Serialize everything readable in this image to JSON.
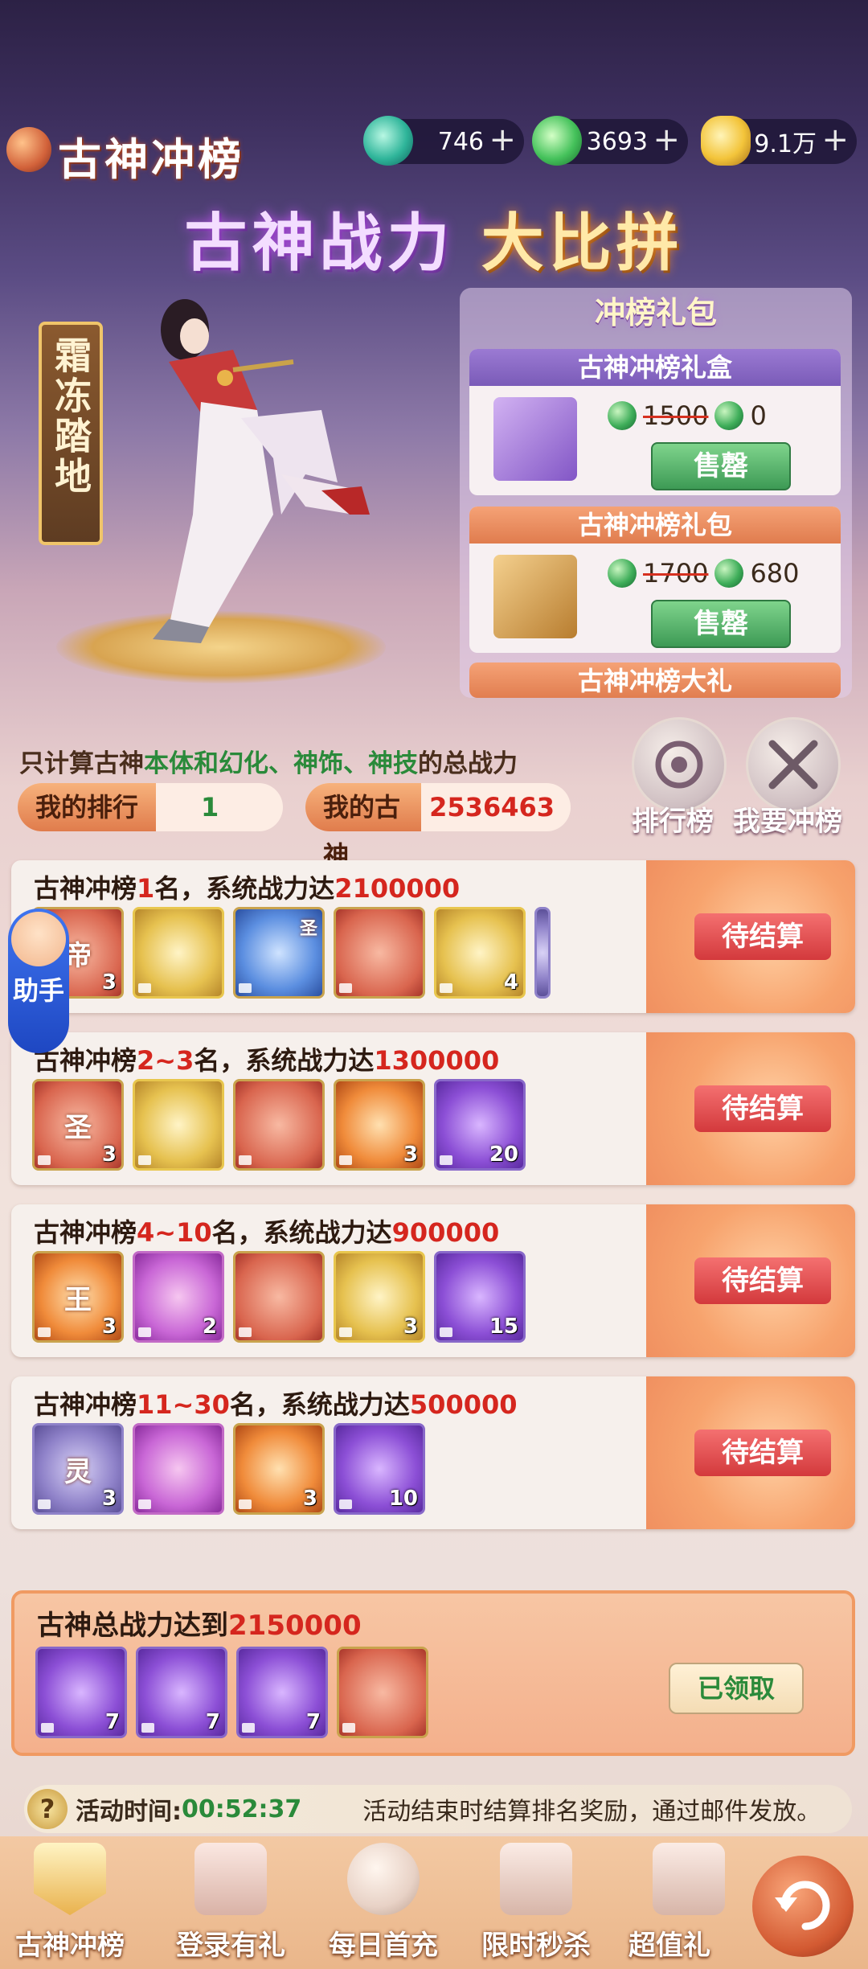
{
  "header": {
    "title": "古神冲榜",
    "currencies": [
      {
        "name": "jade-currency",
        "value": "746"
      },
      {
        "name": "green-jade-currency",
        "value": "3693"
      },
      {
        "name": "gold-ingot-currency",
        "value": "9.1万"
      }
    ]
  },
  "headline": {
    "part1": "古神战力",
    "part2": "大比拼"
  },
  "character": {
    "banner": "霜冻踏地"
  },
  "gift_panel": {
    "title": "冲榜礼包",
    "gifts": [
      {
        "name": "古神冲榜礼盒",
        "old_price": "1500",
        "price": "0",
        "button": "售罄"
      },
      {
        "name": "古神冲榜礼包",
        "old_price": "1700",
        "price": "680",
        "button": "售罄"
      },
      {
        "name": "古神冲榜大礼"
      }
    ]
  },
  "info": {
    "note_prefix": "只计算古神",
    "note_highlight": "本体和幻化、神饰、神技",
    "note_suffix": "的总战力",
    "my_rank_label": "我的排行",
    "my_rank_value": "1",
    "my_god_label": "我的古神",
    "my_god_value": "2536463",
    "rank_board_label": "排行榜",
    "go_rank_label": "我要冲榜"
  },
  "rank_cards": [
    {
      "prefix": "古神冲榜",
      "rank": "1",
      "middle": "名，系统战力达",
      "power": "2100000",
      "button": "待结算",
      "items": [
        {
          "glyph": "帝",
          "count": "3"
        },
        {
          "glyph": "",
          "count": ""
        },
        {
          "glyph": "圣",
          "count": ""
        },
        {
          "glyph": "",
          "count": ""
        },
        {
          "glyph": "",
          "count": "4"
        }
      ]
    },
    {
      "prefix": "古神冲榜",
      "rank": "2~3",
      "middle": "名，系统战力达",
      "power": "1300000",
      "button": "待结算",
      "items": [
        {
          "glyph": "圣",
          "count": "3"
        },
        {
          "glyph": "",
          "count": ""
        },
        {
          "glyph": "",
          "count": ""
        },
        {
          "glyph": "",
          "count": "3"
        },
        {
          "glyph": "",
          "count": "20"
        }
      ]
    },
    {
      "prefix": "古神冲榜",
      "rank": "4~10",
      "middle": "名，系统战力达",
      "power": "900000",
      "button": "待结算",
      "items": [
        {
          "glyph": "王",
          "count": "3"
        },
        {
          "glyph": "",
          "count": "2"
        },
        {
          "glyph": "",
          "count": ""
        },
        {
          "glyph": "",
          "count": "3"
        },
        {
          "glyph": "",
          "count": "15"
        }
      ]
    },
    {
      "prefix": "古神冲榜",
      "rank": "11~30",
      "middle": "名，系统战力达",
      "power": "500000",
      "button": "待结算",
      "items": [
        {
          "glyph": "灵",
          "count": "3"
        },
        {
          "glyph": "",
          "count": ""
        },
        {
          "glyph": "",
          "count": "3"
        },
        {
          "glyph": "",
          "count": "10"
        }
      ]
    }
  ],
  "total_card": {
    "prefix": "古神总战力达到",
    "power": "2150000",
    "button": "已领取",
    "items": [
      {
        "count": "7"
      },
      {
        "count": "7"
      },
      {
        "count": "7"
      },
      {
        "count": ""
      }
    ]
  },
  "helper": {
    "label": "助手"
  },
  "time_bar": {
    "label": "活动时间:",
    "time": "00:52:37",
    "desc": "活动结束时结算排名奖励，通过邮件发放。"
  },
  "bottom_nav": [
    {
      "label": "古神冲榜"
    },
    {
      "label": "登录有礼"
    },
    {
      "label": "每日首充"
    },
    {
      "label": "限时秒杀"
    },
    {
      "label": "超值礼"
    }
  ]
}
